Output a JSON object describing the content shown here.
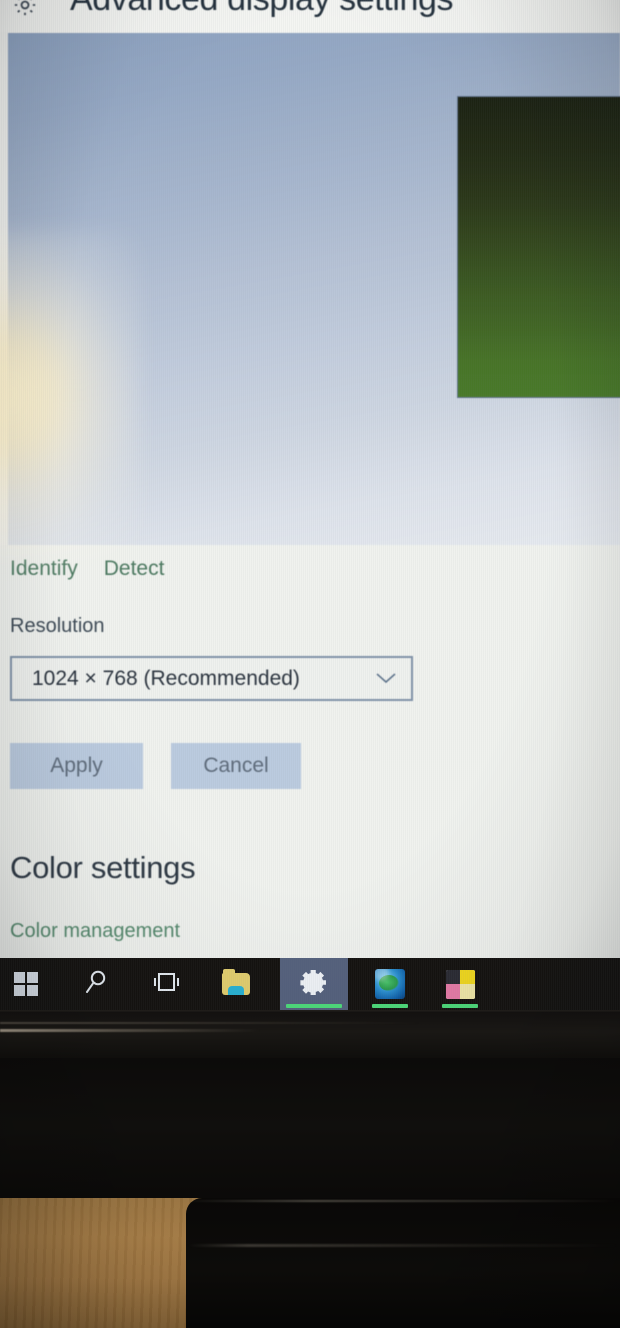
{
  "window": {
    "title": "Advanced display settings",
    "title_icon": "gear-icon"
  },
  "preview": {
    "monitor_thumbnail_label": "display-preview-thumbnail"
  },
  "actions": {
    "identify_label": "Identify",
    "detect_label": "Detect"
  },
  "resolution": {
    "label": "Resolution",
    "selected": "1024 × 768 (Recommended)",
    "dropdown_icon": "chevron-down-icon"
  },
  "buttons": {
    "apply_label": "Apply",
    "cancel_label": "Cancel"
  },
  "color_section": {
    "heading": "Color settings",
    "link": "Color management"
  },
  "taskbar": {
    "items": [
      {
        "name": "start-button",
        "icon": "windows-logo-icon",
        "active": false,
        "running": false
      },
      {
        "name": "search-button",
        "icon": "search-icon",
        "active": false,
        "running": false
      },
      {
        "name": "task-view-button",
        "icon": "task-view-icon",
        "active": false,
        "running": false
      },
      {
        "name": "file-explorer",
        "icon": "folder-icon",
        "active": false,
        "running": false
      },
      {
        "name": "settings-app",
        "icon": "gear-icon",
        "active": true,
        "running": true
      },
      {
        "name": "browser-app",
        "icon": "globe-icon",
        "active": false,
        "running": true
      },
      {
        "name": "color-app",
        "icon": "color-swatch-icon",
        "active": false,
        "running": true
      }
    ]
  },
  "colors": {
    "link_green": "#467a5e",
    "heading_dark": "#2b3744",
    "button_blue": "#b9cbe2",
    "combo_border": "#7f93ac",
    "taskbar_black": "#14120f",
    "taskbar_active": "#55617d",
    "running_indicator_green": "#4ddb7a",
    "preview_top_blue": "#8ba2c4",
    "thumbnail_green": "#457c20",
    "desk_wood": "#a67c45"
  }
}
